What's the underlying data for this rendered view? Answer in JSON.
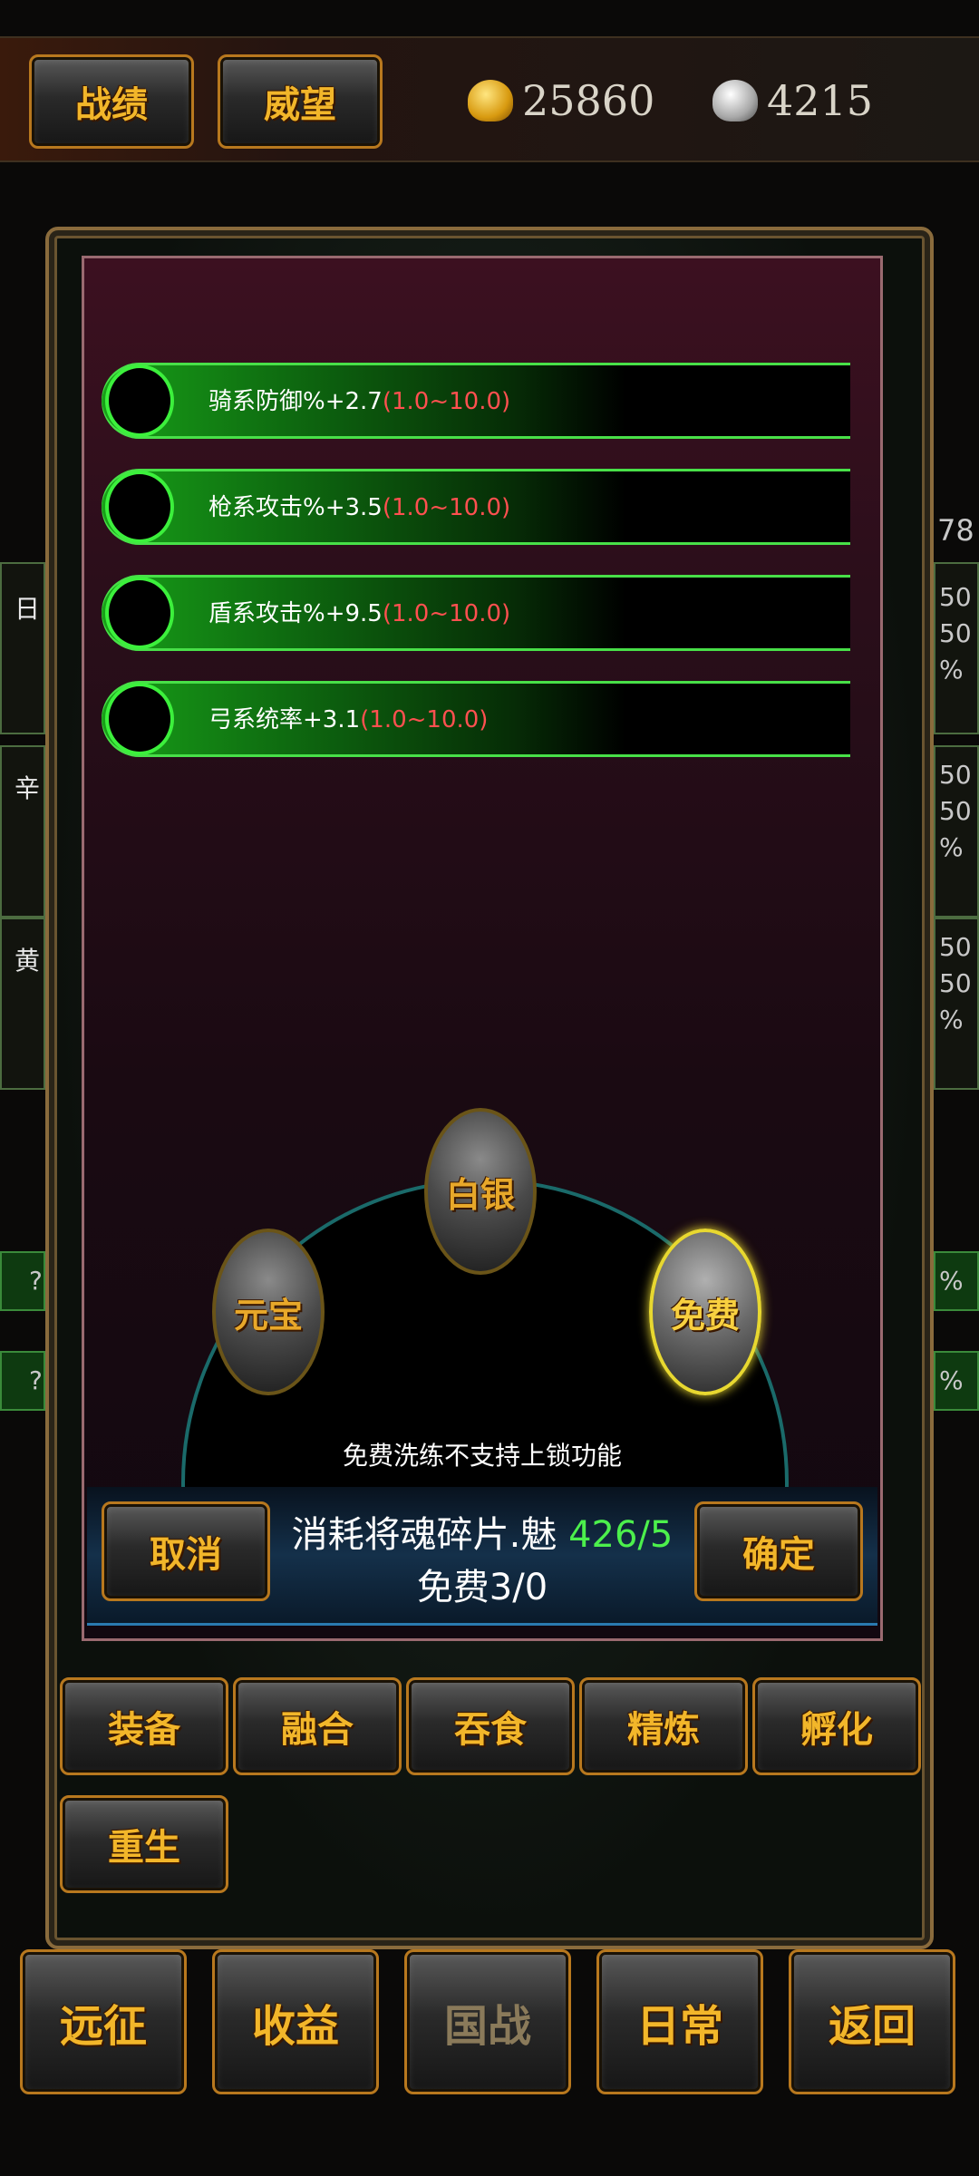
{
  "top_bar": {
    "record_label": "战绩",
    "prestige_label": "威望",
    "gold_amount": "25860",
    "silver_amount": "4215"
  },
  "background": {
    "side_number": "78",
    "left_chars": [
      "日",
      "辛",
      "黄"
    ],
    "right_values": [
      "50",
      "50",
      "%",
      "50",
      "50",
      "%",
      "50",
      "50",
      "%"
    ],
    "question_marks": [
      "?",
      "?"
    ],
    "right_percents": [
      "%",
      "%"
    ]
  },
  "attributes": [
    {
      "text": "骑系防御%+2.7",
      "range": "(1.0~10.0)"
    },
    {
      "text": "枪系攻击%+3.5",
      "range": "(1.0~10.0)"
    },
    {
      "text": "盾系攻击%+9.5",
      "range": "(1.0~10.0)"
    },
    {
      "text": "弓系统率+3.1",
      "range": "(1.0~10.0)"
    }
  ],
  "refine_options": {
    "silver": "白银",
    "ingot": "元宝",
    "free": "免费",
    "selected": "免费"
  },
  "notice": "免费洗练不支持上锁功能",
  "cost": {
    "label": "消耗将魂碎片.魅",
    "amount": "426/5",
    "free_label": "免费3/0"
  },
  "dialog_buttons": {
    "cancel": "取消",
    "confirm": "确定"
  },
  "function_tabs": [
    "装备",
    "融合",
    "吞食",
    "精炼",
    "孵化",
    "重生"
  ],
  "bottom_nav": [
    "远征",
    "收益",
    "国战",
    "日常",
    "返回"
  ],
  "colors": {
    "gold_text": "#f2b62a",
    "attr_green": "#3cf03c",
    "range_red": "#ff5050",
    "amount_green": "#4cf04c",
    "panel_maroon": "#3c1020"
  }
}
